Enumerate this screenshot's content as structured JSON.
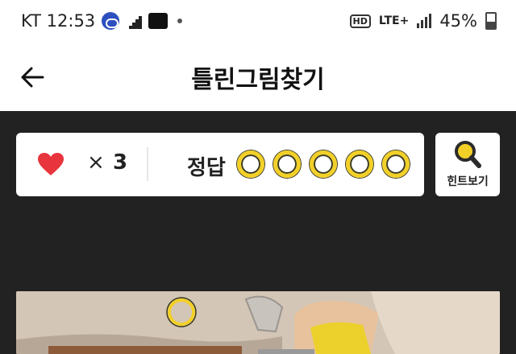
{
  "status_bar": {
    "time": "KT 12:53",
    "battery": "45%",
    "network": "LTE+",
    "hd": "HD"
  },
  "header": {
    "title": "틀린그림찾기"
  },
  "score_card": {
    "times_symbol": "×",
    "lives": "3",
    "answer_label": "정답",
    "answer_slots": 5
  },
  "hint_button": {
    "label": "힌트보기"
  },
  "icons": {
    "back": "arrow-left-icon",
    "heart": "heart-icon",
    "hint": "magnifier-icon"
  },
  "colors": {
    "accent_yellow": "#f3d027",
    "heart_red": "#e8343c",
    "dark_bg": "#222222"
  }
}
